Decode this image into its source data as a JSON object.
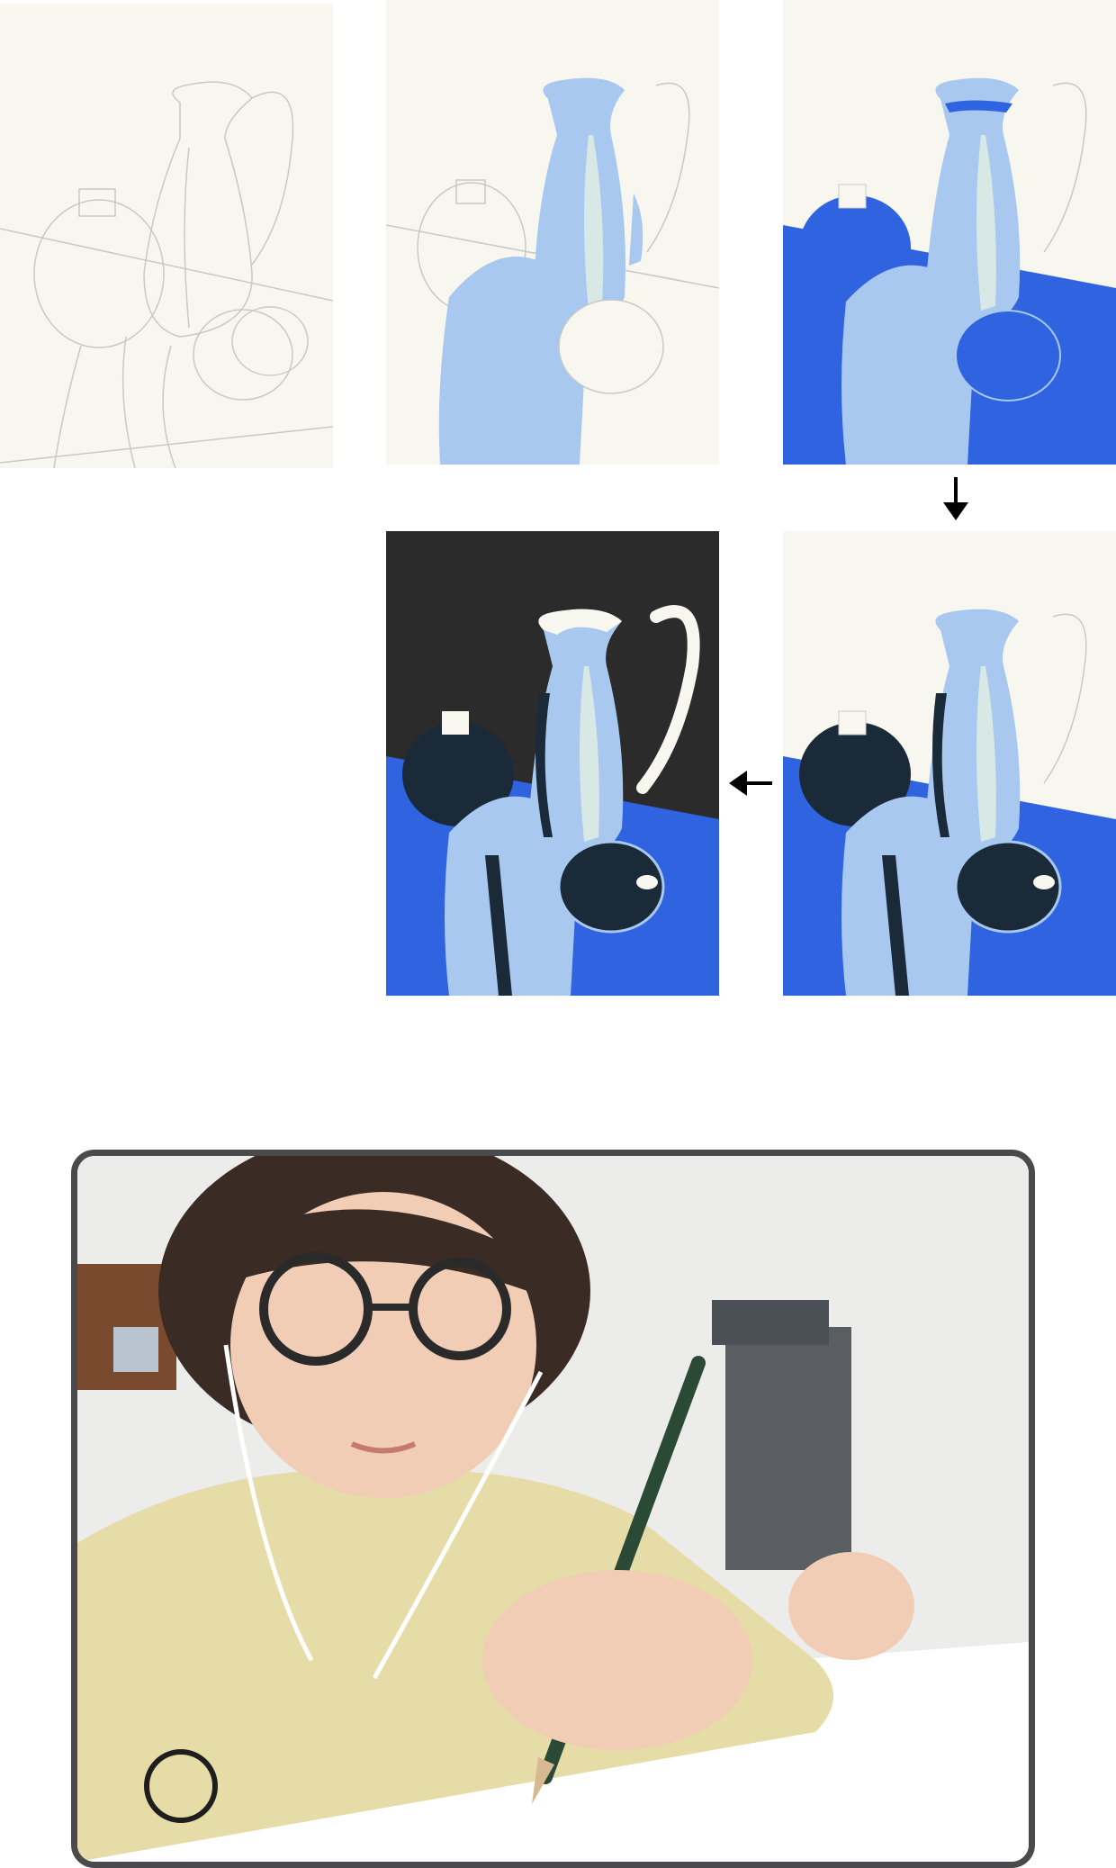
{
  "steps": [
    {
      "id": "sketch",
      "icon": "pencil-sketch"
    },
    {
      "id": "light-blue-fill",
      "icon": "light-blue-shape"
    },
    {
      "id": "blue-background",
      "icon": "blue-shape"
    },
    {
      "id": "dark-accents",
      "icon": "dark-shape"
    },
    {
      "id": "black-background",
      "icon": "black-backdrop"
    }
  ],
  "arrows": [
    {
      "from": "blue-background",
      "to": "dark-accents",
      "direction": "down"
    },
    {
      "from": "dark-accents",
      "to": "black-background",
      "direction": "left"
    }
  ],
  "colors": {
    "paper": "#f7f7ef",
    "pencil": "#c8c8c8",
    "light_blue": "#a8c8f0",
    "pale_teal": "#d8e8e4",
    "royal_blue": "#2f63e0",
    "dark_navy": "#1a2a38",
    "black_bg": "#2b2b2b",
    "frame": "#4a4a4d",
    "shirt": "#e6dca8"
  },
  "photo": {
    "subject": "person-drawing-with-pencil"
  }
}
